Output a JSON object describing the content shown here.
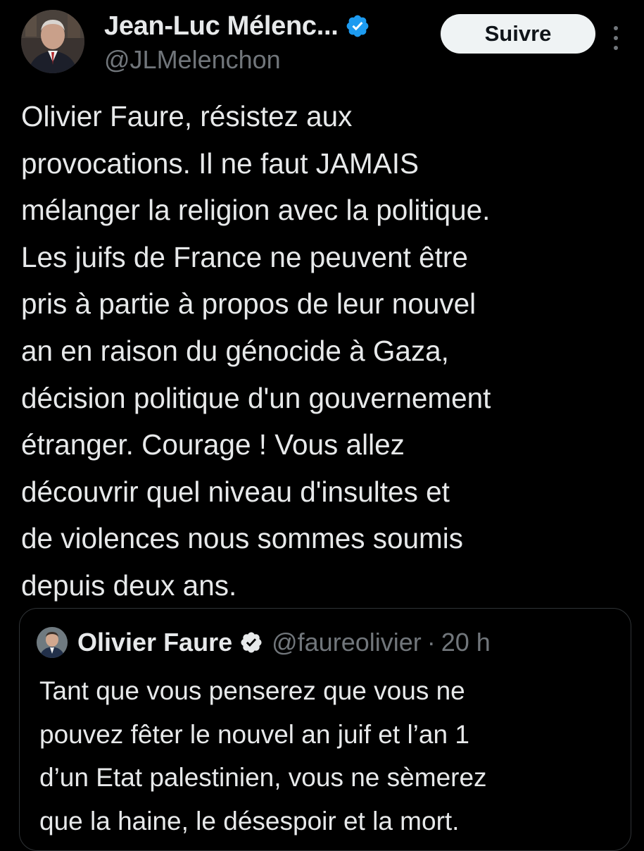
{
  "author": {
    "display_name": "Jean-Luc Mélenc...",
    "handle": "@JLMelenchon",
    "verified": true
  },
  "follow_button": {
    "label": "Suivre"
  },
  "tweet": {
    "text": "Olivier Faure, résistez aux\nprovocations. Il ne faut JAMAIS\nmélanger la religion avec la politique.\nLes juifs de France ne peuvent être\npris à partie à propos de leur nouvel\nan en raison du génocide à Gaza,\ndécision politique d'un gouvernement\nétranger. Courage ! Vous allez\ndécouvrir quel niveau d'insultes et\nde violences nous sommes soumis\ndepuis deux ans."
  },
  "quoted_tweet": {
    "author_name": "Olivier Faure",
    "handle": "@faureolivier",
    "separator": "·",
    "time": "20 h",
    "verified": true,
    "text": "Tant que vous penserez que vous ne\npouvez fêter le nouvel an juif et l’an 1\nd’un Etat palestinien, vous ne sèmerez\nque la haine, le désespoir et la mort."
  },
  "colors": {
    "background": "#000000",
    "text_primary": "#e7e9ea",
    "text_secondary": "#71767b",
    "verified_blue": "#1d9bf0",
    "follow_button_bg": "#eff3f4",
    "card_border": "#2f3336"
  },
  "icons": {
    "verified": "verified-badge-icon",
    "more": "more-options-icon"
  }
}
